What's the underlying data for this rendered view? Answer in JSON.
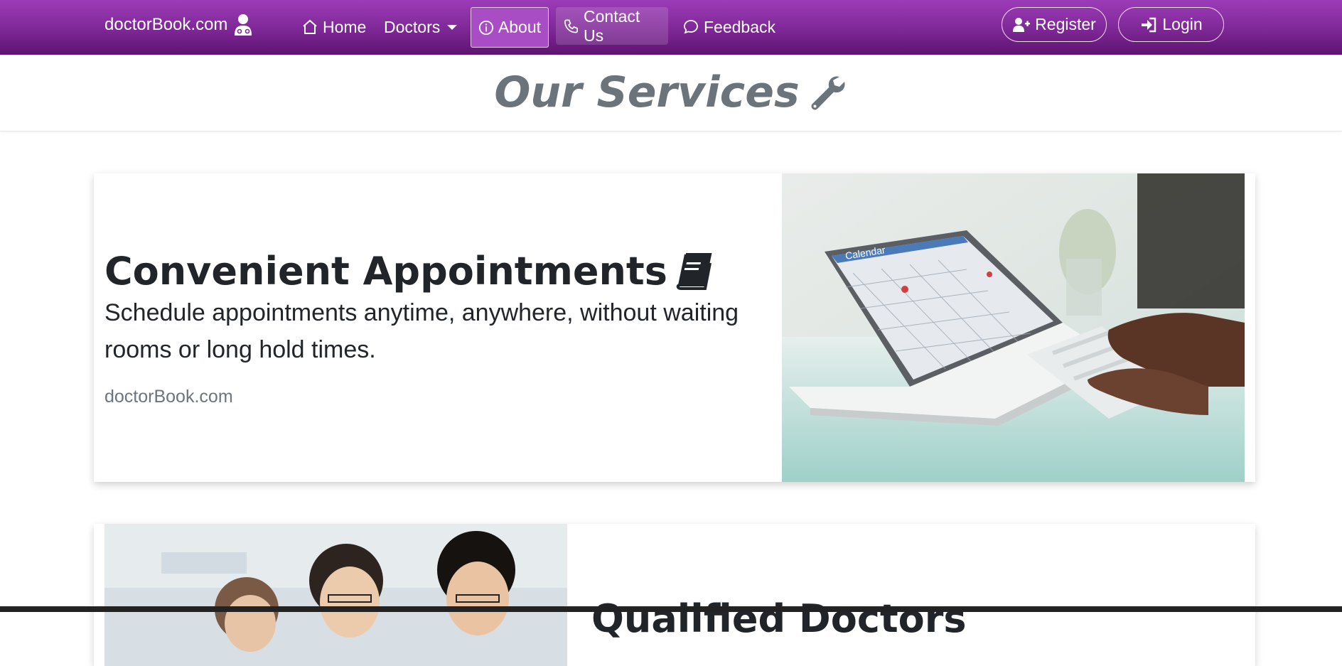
{
  "nav": {
    "brand": "doctorBook.com",
    "links": [
      {
        "label": "Home",
        "icon": "home-icon"
      },
      {
        "label": "Doctors",
        "icon": "none",
        "dropdown": true
      },
      {
        "label": "About",
        "icon": "info-circle-icon",
        "active": true
      },
      {
        "label": "Contact Us",
        "icon": "phone-icon"
      },
      {
        "label": "Feedback",
        "icon": "chat-bubble-icon"
      }
    ],
    "register": "Register",
    "login": "Login"
  },
  "header": {
    "title": "Our Services"
  },
  "cards": [
    {
      "title": "Convenient Appointments",
      "text": "Schedule appointments anytime, anywhere, without waiting rooms or long hold times.",
      "footer": "doctorBook.com",
      "image_text": "Calendar"
    },
    {
      "title": "Qualified Doctors"
    }
  ],
  "colors": {
    "nav_gradient_top": "#9c3cb8",
    "nav_gradient_bottom": "#5e1470",
    "title_gray": "#6b737b"
  }
}
